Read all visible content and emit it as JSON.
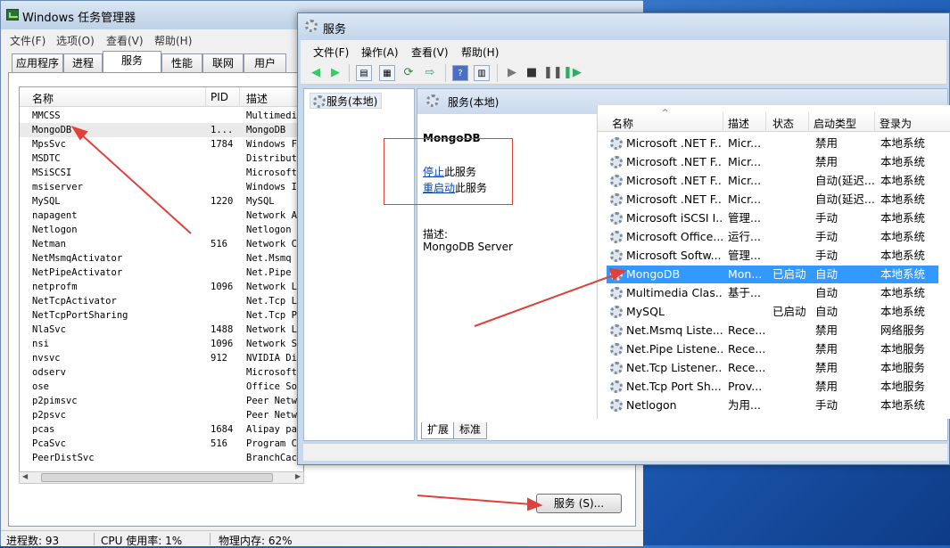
{
  "taskmgr": {
    "title": "Windows 任务管理器",
    "menu": [
      "文件(F)",
      "选项(O)",
      "查看(V)",
      "帮助(H)"
    ],
    "tabs": [
      "应用程序",
      "进程",
      "服务",
      "性能",
      "联网",
      "用户"
    ],
    "active_tab": "服务",
    "columns": [
      "名称",
      "PID",
      "描述"
    ],
    "rows": [
      {
        "name": "MMCSS",
        "pid": "",
        "desc": "Multimedia"
      },
      {
        "name": "MongoDB",
        "pid": "1...",
        "desc": "MongoDB"
      },
      {
        "name": "MpsSvc",
        "pid": "1784",
        "desc": "Windows Fi"
      },
      {
        "name": "MSDTC",
        "pid": "",
        "desc": "Distribute"
      },
      {
        "name": "MSiSCSI",
        "pid": "",
        "desc": "Microsoft"
      },
      {
        "name": "msiserver",
        "pid": "",
        "desc": "Windows In"
      },
      {
        "name": "MySQL",
        "pid": "1220",
        "desc": "MySQL"
      },
      {
        "name": "napagent",
        "pid": "",
        "desc": "Network Ac"
      },
      {
        "name": "Netlogon",
        "pid": "",
        "desc": "Netlogon"
      },
      {
        "name": "Netman",
        "pid": "516",
        "desc": "Network Co"
      },
      {
        "name": "NetMsmqActivator",
        "pid": "",
        "desc": "Net.Msmq L"
      },
      {
        "name": "NetPipeActivator",
        "pid": "",
        "desc": "Net.Pipe L"
      },
      {
        "name": "netprofm",
        "pid": "1096",
        "desc": "Network Li"
      },
      {
        "name": "NetTcpActivator",
        "pid": "",
        "desc": "Net.Tcp Li"
      },
      {
        "name": "NetTcpPortSharing",
        "pid": "",
        "desc": "Net.Tcp Po"
      },
      {
        "name": "NlaSvc",
        "pid": "1488",
        "desc": "Network Lo"
      },
      {
        "name": "nsi",
        "pid": "1096",
        "desc": "Network St"
      },
      {
        "name": "nvsvc",
        "pid": "912",
        "desc": "NVIDIA Dis"
      },
      {
        "name": "odserv",
        "pid": "",
        "desc": "Microsoft"
      },
      {
        "name": "ose",
        "pid": "",
        "desc": "Office Sou"
      },
      {
        "name": "p2pimsvc",
        "pid": "",
        "desc": "Peer Netwo"
      },
      {
        "name": "p2psvc",
        "pid": "",
        "desc": "Peer Netwo"
      },
      {
        "name": "pcas",
        "pid": "1684",
        "desc": "Alipay pay"
      },
      {
        "name": "PcaSvc",
        "pid": "516",
        "desc": "Program Co"
      },
      {
        "name": "PeerDistSvc",
        "pid": "",
        "desc": "BranchCach"
      }
    ],
    "services_button": "服务 (S)...",
    "status": {
      "processes": "进程数: 93",
      "cpu": "CPU 使用率: 1%",
      "memory": "物理内存: 62%"
    }
  },
  "services": {
    "title": "服务",
    "menu": [
      "文件(F)",
      "操作(A)",
      "查看(V)",
      "帮助(H)"
    ],
    "tree_node": "服务(本地)",
    "header_title": "服务(本地)",
    "selected_name": "MongoDB",
    "stop_link": "停止",
    "stop_suffix": "此服务",
    "restart_link": "重启动",
    "restart_suffix": "此服务",
    "desc_label": "描述:",
    "desc_value": "MongoDB Server",
    "tabs": [
      "扩展",
      "标准"
    ],
    "columns": [
      "名称",
      "描述",
      "状态",
      "启动类型",
      "登录为"
    ],
    "rows": [
      {
        "name": "Microsoft .NET F...",
        "desc": "Micr...",
        "status": "",
        "startup": "禁用",
        "logon": "本地系统"
      },
      {
        "name": "Microsoft .NET F...",
        "desc": "Micr...",
        "status": "",
        "startup": "禁用",
        "logon": "本地系统"
      },
      {
        "name": "Microsoft .NET F...",
        "desc": "Micr...",
        "status": "",
        "startup": "自动(延迟...",
        "logon": "本地系统"
      },
      {
        "name": "Microsoft .NET F...",
        "desc": "Micr...",
        "status": "",
        "startup": "自动(延迟...",
        "logon": "本地系统"
      },
      {
        "name": "Microsoft iSCSI I...",
        "desc": "管理...",
        "status": "",
        "startup": "手动",
        "logon": "本地系统"
      },
      {
        "name": "Microsoft Office...",
        "desc": "运行...",
        "status": "",
        "startup": "手动",
        "logon": "本地系统"
      },
      {
        "name": "Microsoft Softw...",
        "desc": "管理...",
        "status": "",
        "startup": "手动",
        "logon": "本地系统"
      },
      {
        "name": "MongoDB",
        "desc": "Mon...",
        "status": "已启动",
        "startup": "自动",
        "logon": "本地系统"
      },
      {
        "name": "Multimedia Clas...",
        "desc": "基于...",
        "status": "",
        "startup": "自动",
        "logon": "本地系统"
      },
      {
        "name": "MySQL",
        "desc": "",
        "status": "已启动",
        "startup": "自动",
        "logon": "本地系统"
      },
      {
        "name": "Net.Msmq Liste...",
        "desc": "Rece...",
        "status": "",
        "startup": "禁用",
        "logon": "网络服务"
      },
      {
        "name": "Net.Pipe Listene...",
        "desc": "Rece...",
        "status": "",
        "startup": "禁用",
        "logon": "本地服务"
      },
      {
        "name": "Net.Tcp Listener...",
        "desc": "Rece...",
        "status": "",
        "startup": "禁用",
        "logon": "本地服务"
      },
      {
        "name": "Net.Tcp Port Sh...",
        "desc": "Prov...",
        "status": "",
        "startup": "禁用",
        "logon": "本地服务"
      },
      {
        "name": "Netlogon",
        "desc": "为用...",
        "status": "",
        "startup": "手动",
        "logon": "本地系统"
      }
    ]
  },
  "colors": {
    "annotation": "#e0413a",
    "selection": "#3399ff",
    "link": "#0645ad"
  }
}
